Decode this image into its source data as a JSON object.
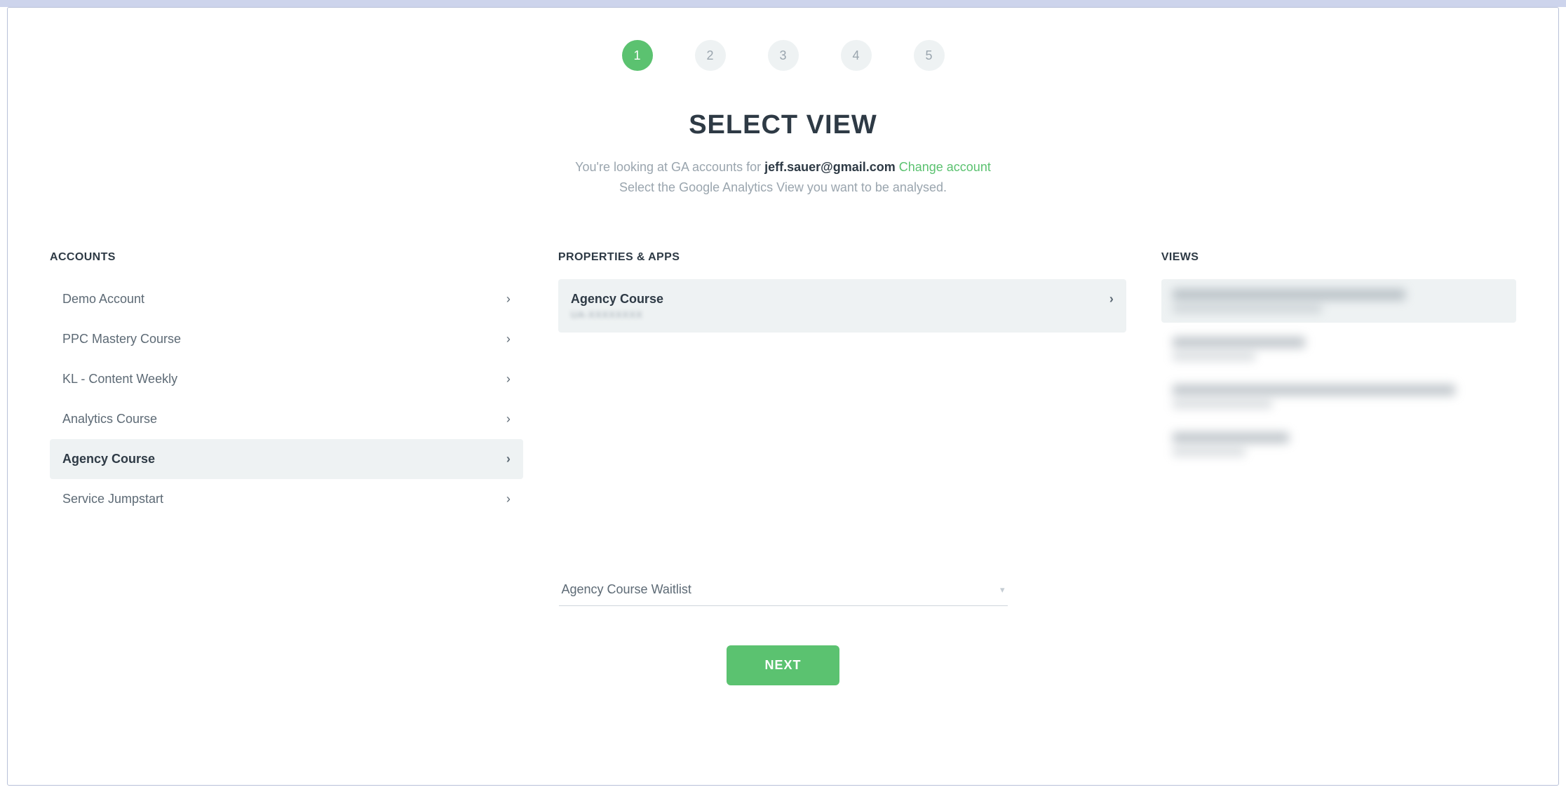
{
  "stepper": {
    "steps": [
      "1",
      "2",
      "3",
      "4",
      "5"
    ],
    "active_index": 0
  },
  "heading": {
    "title": "SELECT VIEW",
    "subline_prefix": "You're looking at GA accounts for ",
    "email": "jeff.sauer@gmail.com",
    "change_link": "Change account",
    "subline2": "Select the Google Analytics View you want to be analysed."
  },
  "columns": {
    "accounts": {
      "title": "ACCOUNTS",
      "items": [
        {
          "label": "Demo Account",
          "selected": false
        },
        {
          "label": "PPC Mastery Course",
          "selected": false
        },
        {
          "label": "KL - Content Weekly",
          "selected": false
        },
        {
          "label": "Analytics Course",
          "selected": false
        },
        {
          "label": "Agency Course",
          "selected": true
        },
        {
          "label": "Service Jumpstart",
          "selected": false
        }
      ]
    },
    "properties": {
      "title": "PROPERTIES & APPS",
      "items": [
        {
          "label": "Agency Course",
          "sub": "UA-XXXXXXXX",
          "selected": true
        }
      ]
    },
    "views": {
      "title": "VIEWS",
      "items": [
        {
          "selected": true,
          "w1": "70%"
        },
        {
          "selected": false,
          "w1": "40%"
        },
        {
          "selected": false,
          "w1": "85%"
        },
        {
          "selected": false,
          "w1": "35%"
        }
      ]
    }
  },
  "footer": {
    "selected_value": "Agency Course Waitlist",
    "next_label": "NEXT"
  }
}
